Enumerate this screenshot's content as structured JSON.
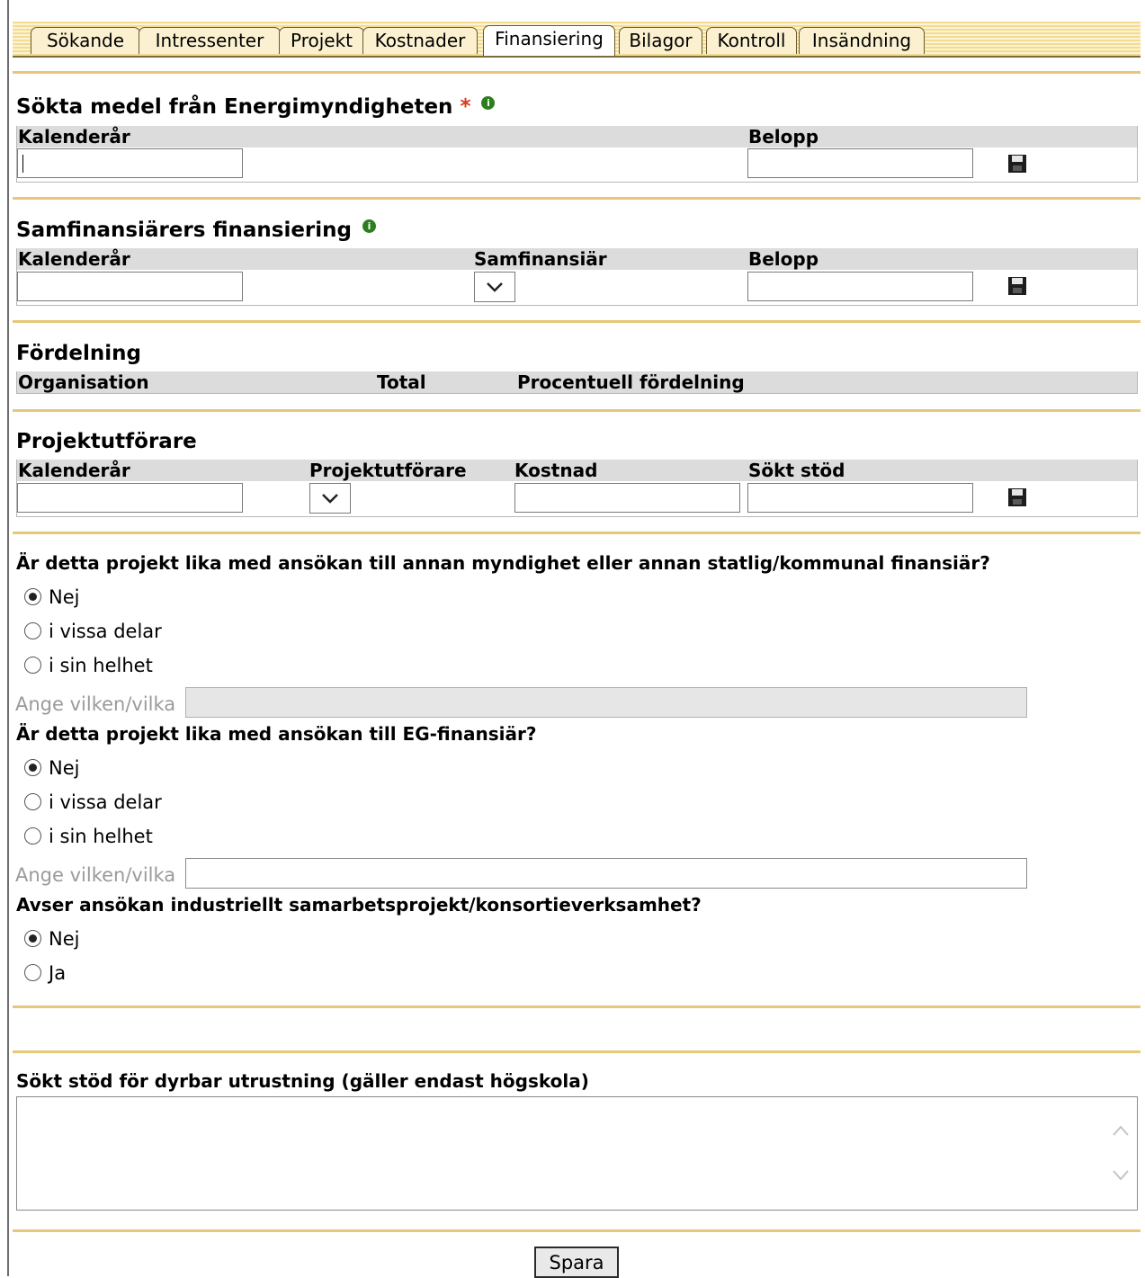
{
  "tabs": [
    {
      "label": "Sökande",
      "active": false
    },
    {
      "label": "Intressenter",
      "active": false
    },
    {
      "label": "Projekt",
      "active": false
    },
    {
      "label": "Kostnader",
      "active": false
    },
    {
      "label": "Finansiering",
      "active": true
    },
    {
      "label": "Bilagor",
      "active": false
    },
    {
      "label": "Kontroll",
      "active": false
    },
    {
      "label": "Insändning",
      "active": false
    }
  ],
  "sokta_medel": {
    "title": "Sökta medel från Energimyndigheten",
    "required_mark": "*",
    "info_icon": "i",
    "col_year": "Kalenderår",
    "col_amount": "Belopp",
    "year_value": "",
    "amount_value": ""
  },
  "samfinans": {
    "title": "Samfinansiärers finansiering",
    "info_icon": "i",
    "col_year": "Kalenderår",
    "col_financier": "Samfinansiär",
    "col_amount": "Belopp",
    "financier_selected": ""
  },
  "fordelning": {
    "title": "Fördelning",
    "col_org": "Organisation",
    "col_total": "Total",
    "col_percent": "Procentuell fördelning"
  },
  "projektutforare": {
    "title": "Projektutförare",
    "col_year": "Kalenderår",
    "col_executor": "Projektutförare",
    "col_cost": "Kostnad",
    "col_support": "Sökt stöd",
    "executor_selected": ""
  },
  "q1": {
    "text": "Är detta projekt lika med ansökan till annan myndighet eller annan statlig/kommunal finansiär?",
    "options": [
      "Nej",
      "i vissa delar",
      "i sin helhet"
    ],
    "selected": "Nej",
    "specify_label": "Ange vilken/vilka",
    "specify_value": "",
    "specify_disabled": true
  },
  "q2": {
    "text": "Är detta projekt lika med ansökan till EG-finansiär?",
    "options": [
      "Nej",
      "i vissa delar",
      "i sin helhet"
    ],
    "selected": "Nej",
    "specify_label": "Ange vilken/vilka",
    "specify_value": "",
    "specify_disabled": false
  },
  "q3": {
    "text": "Avser ansökan industriellt samarbetsprojekt/konsortieverksamhet?",
    "options": [
      "Nej",
      "Ja"
    ],
    "selected": "Nej"
  },
  "equipment": {
    "label": "Sökt stöd för dyrbar utrustning (gäller endast högskola)",
    "value": ""
  },
  "save_button": "Spara",
  "colors": {
    "tab_bar": "#f3dc91",
    "divider": "#e7c778",
    "table_header": "#dcdcdc",
    "required": "#d63b1b",
    "info": "#2e7d1f"
  }
}
